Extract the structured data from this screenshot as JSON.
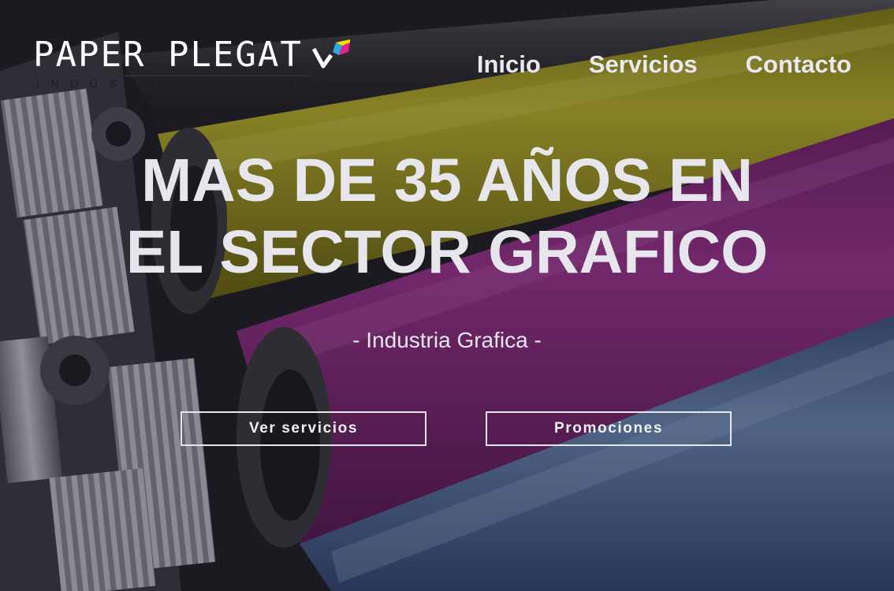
{
  "brand": {
    "name": "PAPER PLEGAT",
    "tagline": "INDÚSTRIA GRÀFICA",
    "logo_colors": [
      "#ffffff",
      "#2aa8e0",
      "#e0218a",
      "#f2e600"
    ]
  },
  "nav": {
    "items": [
      {
        "label": "Inicio"
      },
      {
        "label": "Servicios"
      },
      {
        "label": "Contacto"
      }
    ]
  },
  "hero": {
    "headline_line1": "MAS DE 35 AÑOS EN",
    "headline_line2": "EL SECTOR GRAFICO",
    "subtitle": "- Industria Grafica -",
    "buttons": {
      "services_label": "Ver servicios",
      "promotions_label": "Promociones"
    },
    "background": {
      "description_icon": "printing-rollers-image",
      "roller_colors": [
        "#2b2b2f",
        "#b8b21a",
        "#9a2c8c",
        "#4f6f9c"
      ]
    }
  }
}
